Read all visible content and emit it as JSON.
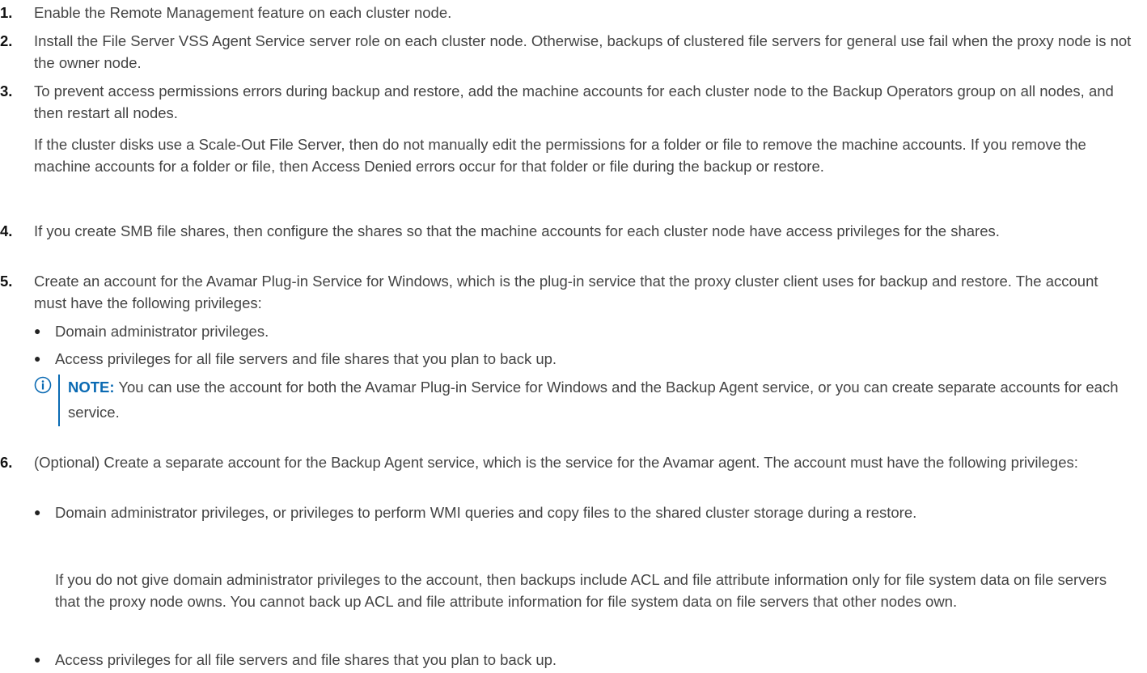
{
  "steps": [
    {
      "number": "1.",
      "text": "Enable the Remote Management feature on each cluster node."
    },
    {
      "number": "2.",
      "text": "Install the File Server VSS Agent Service server role on each cluster node. Otherwise, backups of clustered file servers for general use fail when the proxy node is not the owner node."
    },
    {
      "number": "3.",
      "text": "To prevent access permissions errors during backup and restore, add the machine accounts for each cluster node to the Backup Operators group on all nodes, and then restart all nodes.",
      "para": "If the cluster disks use a Scale-Out File Server, then do not manually edit the permissions for a folder or file to remove the machine accounts. If you remove the machine accounts for a folder or file, then Access Denied errors occur for that folder or file during the backup or restore."
    },
    {
      "number": "4.",
      "text": "If you create SMB file shares, then configure the shares so that the machine accounts for each cluster node have access privileges for the shares."
    },
    {
      "number": "5.",
      "text": "Create an account for the Avamar Plug-in Service for Windows, which is the plug-in service that the proxy cluster client uses for backup and restore. The account must have the following privileges:",
      "bullets": [
        "Domain administrator privileges.",
        "Access privileges for all file servers and file shares that you plan to back up."
      ],
      "note": {
        "label": "NOTE:",
        "text": " You can use the account for both the Avamar Plug-in Service for Windows and the Backup Agent service, or you can create separate accounts for each service."
      }
    },
    {
      "number": "6.",
      "text": "(Optional) Create a separate account for the Backup Agent service, which is the service for the Avamar agent. The account must have the following privileges:",
      "bullets": [
        "Domain administrator privileges, or privileges to perform WMI queries and copy files to the shared cluster storage during a restore.",
        "Access privileges for all file servers and file shares that you plan to back up."
      ],
      "bullet_para": "If you do not give domain administrator privileges to the account, then backups include ACL and file attribute information only for file system data on file servers that the proxy node owns. You cannot back up ACL and file attribute information for file system data on file servers that other nodes own."
    }
  ],
  "colors": {
    "text": "#444444",
    "number": "#111111",
    "note_accent": "#0a6ab3"
  },
  "icons": {
    "note": "info-circle-icon",
    "bullet": "bullet-dot-icon"
  }
}
